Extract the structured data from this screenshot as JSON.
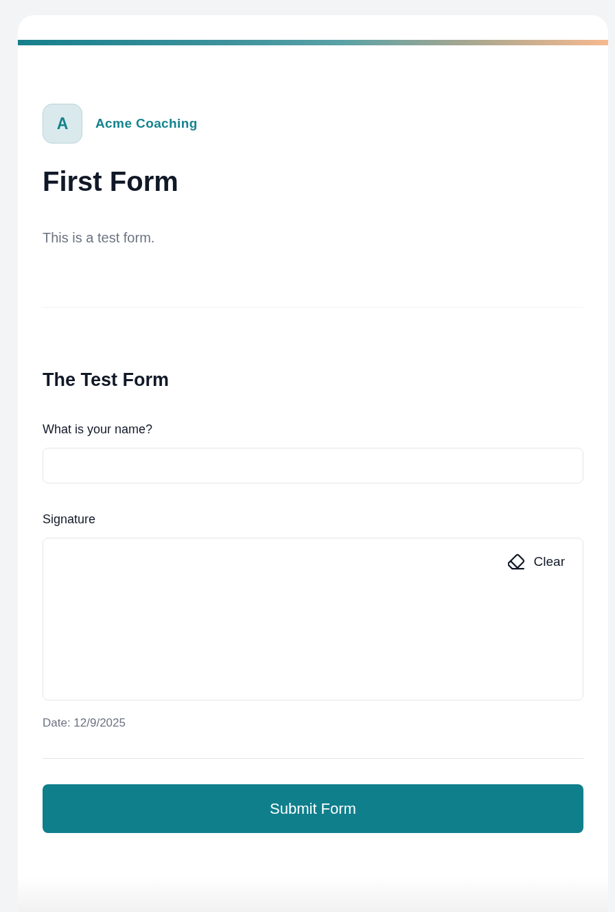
{
  "brand": {
    "initial": "A",
    "name": "Acme Coaching"
  },
  "header": {
    "title": "First Form",
    "description": "This is a test form."
  },
  "section": {
    "title": "The Test Form"
  },
  "fields": [
    {
      "kind": "text",
      "label": "What is your name?"
    },
    {
      "kind": "signature",
      "label": "Signature",
      "clear_button": "Clear",
      "date": "Date: 12/9/2025"
    }
  ],
  "submit_button": "Submit Form"
}
